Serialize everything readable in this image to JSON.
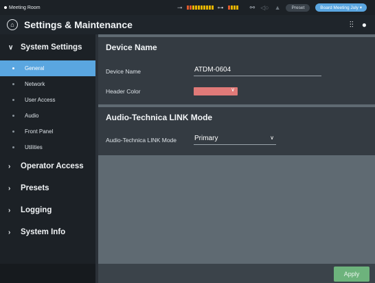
{
  "status_bar": {
    "room_name": "Meeting Room",
    "preset_label": "Preset",
    "preset_value": "Board Meeting July",
    "icons": [
      "input-meter-icon",
      "output-meter-icon",
      "link-icon",
      "signal-icon",
      "warning-icon"
    ]
  },
  "header": {
    "title": "Settings & Maintenance"
  },
  "sidebar": {
    "sections": [
      {
        "label": "System Settings",
        "expanded": true,
        "items": [
          {
            "label": "General",
            "active": true
          },
          {
            "label": "Network"
          },
          {
            "label": "User Access"
          },
          {
            "label": "Audio"
          },
          {
            "label": "Front Panel"
          },
          {
            "label": "Utilities"
          }
        ]
      },
      {
        "label": "Operator Access"
      },
      {
        "label": "Presets"
      },
      {
        "label": "Logging"
      },
      {
        "label": "System Info"
      }
    ]
  },
  "main": {
    "device_name_panel": {
      "title": "Device Name",
      "device_name_label": "Device Name",
      "device_name_value": "ATDM-0604",
      "header_color_label": "Header Color",
      "header_color_value": "#e07a78"
    },
    "link_mode_panel": {
      "title": "Audio-Technica LINK Mode",
      "link_mode_label": "Audio-Technica LINK Mode",
      "link_mode_value": "Primary"
    },
    "apply_label": "Apply"
  },
  "colors": {
    "accent": "#5aa6e0",
    "apply": "#6db37c",
    "meter_yellow": "#e6b400",
    "meter_red": "#e15b2c"
  }
}
